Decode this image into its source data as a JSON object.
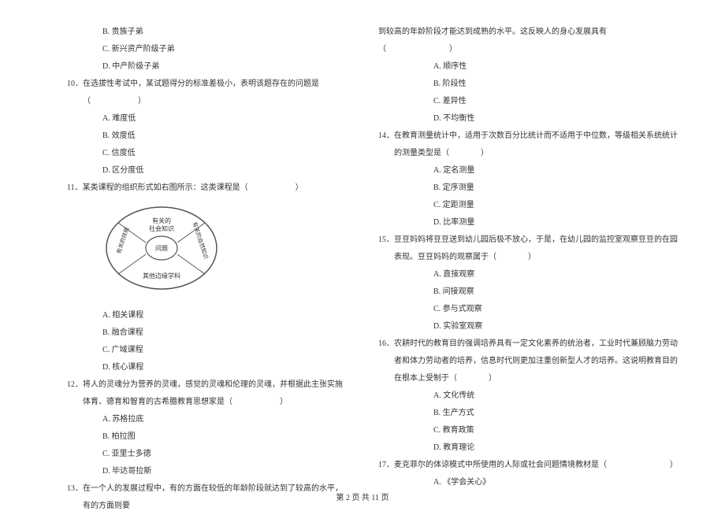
{
  "left_col": {
    "opt_b1": "B. 贵族子弟",
    "opt_c1": "C. 新兴资产阶级子弟",
    "opt_d1": "D. 中产阶级子弟",
    "q10": "10．在选拔性考试中，某试题得分的标准差极小，表明该题存在的问题是（　　　　　　）",
    "q10_a": "A. 难度低",
    "q10_b": "B. 效度低",
    "q10_c": "C. 信度低",
    "q10_d": "D. 区分度低",
    "q11": "11．某类课程的组织形式如右图所示：这类课程是（　　　　　　）",
    "diagram": {
      "top": "有关的社会知识",
      "right": "有关的自然知识",
      "left": "有关的技能",
      "bottom": "其他边缘学科",
      "center": "问题"
    },
    "q11_a": "A. 相关课程",
    "q11_b": "B. 融合课程",
    "q11_c": "C. 广域课程",
    "q11_d": "D. 核心课程",
    "q12": "12．将人的灵魂分为营养的灵魂，感觉的灵魂和伦理的灵魂，并根据此主张实施体育、德育和智育的古希腊教育思想家是（　　　　　　）",
    "q12_a": "A. 苏格拉底",
    "q12_b": "B. 柏拉图",
    "q12_c": "C. 亚里士多德",
    "q12_d": "D. 毕达哥拉斯",
    "q13": "13．在一个人的发展过程中，有的方面在较低的年龄阶段就达到了较高的水平，有的方面则要"
  },
  "right_col": {
    "q13_cont": "到较高的年龄阶段才能达到成熟的水平。这反映人的身心发展具有（　　　　　　　　）",
    "q13_a": "A. 顺序性",
    "q13_b": "B. 阶段性",
    "q13_c": "C. 差异性",
    "q13_d": "D. 不均衡性",
    "q14": "14．在教育测量统计中，适用于次数百分比统计而不适用于中位数，等级相关系统统计的测量类型是（　　　　）",
    "q14_a": "A. 定名测量",
    "q14_b": "B. 定序测量",
    "q14_c": "C. 定距测量",
    "q14_d": "D. 比率测量",
    "q15": "15．豆豆妈妈将豆豆送到幼儿园后极不放心，于是，在幼儿园的监控室观察豆豆的在园表现。豆豆妈妈的观察属于（　　　　）",
    "q15_a": "A. 直接观察",
    "q15_b": "B. 间接观察",
    "q15_c": "C. 参与式观察",
    "q15_d": "D. 实验室观察",
    "q16": "16．农耕时代的教育目的强调培养具有一定文化素养的统治者，工业时代兼顾脑力劳动者和体力劳动者的培养，信息时代则更加注重创新型人才的培养。这说明教育目的在根本上受制于（　　　　）",
    "q16_a": "A. 文化传统",
    "q16_b": "B. 生产方式",
    "q16_c": "C. 教育政策",
    "q16_d": "D. 教育理论",
    "q17": "17．麦克菲尔的体谅模式中所使用的人际或社会问题情境教材是（　　　　　　　　）",
    "q17_a": "A. 《学会关心》"
  },
  "footer": "第 2 页 共 11 页"
}
